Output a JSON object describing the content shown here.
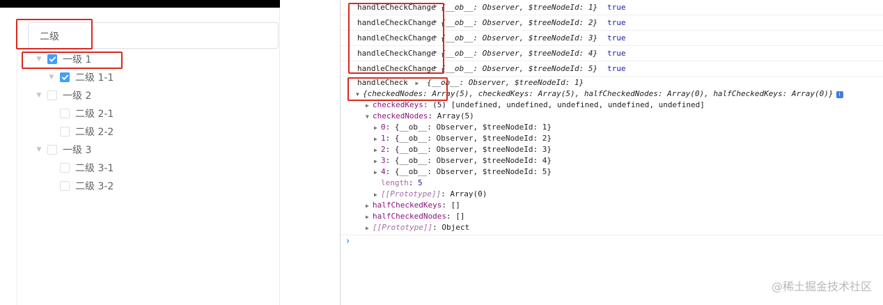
{
  "app": {
    "select_value": "二级",
    "tree": [
      {
        "label": "一级 1",
        "level": 0,
        "expanded": true,
        "checked": true
      },
      {
        "label": "二级 1-1",
        "level": 1,
        "expanded": false,
        "checked": true,
        "caret": true
      },
      {
        "label": "一级 2",
        "level": 0,
        "expanded": true,
        "checked": false
      },
      {
        "label": "二级 2-1",
        "level": 1,
        "checked": false
      },
      {
        "label": "二级 2-2",
        "level": 1,
        "checked": false
      },
      {
        "label": "一级 3",
        "level": 0,
        "expanded": true,
        "checked": false
      },
      {
        "label": "二级 3-1",
        "level": 1,
        "checked": false
      },
      {
        "label": "二级 3-2",
        "level": 1,
        "checked": false
      }
    ]
  },
  "console": {
    "check_change_logs": [
      {
        "name": "handleCheckChange",
        "obj": "{__ob__: Observer, $treeNodeId: 1}",
        "value": "true"
      },
      {
        "name": "handleCheckChange",
        "obj": "{__ob__: Observer, $treeNodeId: 2}",
        "value": "true"
      },
      {
        "name": "handleCheckChange",
        "obj": "{__ob__: Observer, $treeNodeId: 3}",
        "value": "true"
      },
      {
        "name": "handleCheckChange",
        "obj": "{__ob__: Observer, $treeNodeId: 4}",
        "value": "true"
      },
      {
        "name": "handleCheckChange",
        "obj": "{__ob__: Observer, $treeNodeId: 5}",
        "value": "true"
      }
    ],
    "check_log": {
      "name": "handleCheck",
      "obj": "{__ob__: Observer, $treeNodeId: 1}",
      "summary": "{checkedNodes: Array(5), checkedKeys: Array(5), halfCheckedNodes: Array(0), halfCheckedKeys: Array(0)}",
      "checked_keys_key": "checkedKeys",
      "checked_keys_value": "(5) [undefined, undefined, undefined, undefined, undefined]",
      "checked_nodes_key": "checkedNodes",
      "checked_nodes_value": "Array(5)",
      "node_entries": [
        {
          "key": "0",
          "value": "{__ob__: Observer, $treeNodeId: 1}"
        },
        {
          "key": "1",
          "value": "{__ob__: Observer, $treeNodeId: 2}"
        },
        {
          "key": "2",
          "value": "{__ob__: Observer, $treeNodeId: 3}"
        },
        {
          "key": "3",
          "value": "{__ob__: Observer, $treeNodeId: 4}"
        },
        {
          "key": "4",
          "value": "{__ob__: Observer, $treeNodeId: 5}"
        }
      ],
      "length_key": "length",
      "length_value": "5",
      "array_proto_key": "[[Prototype]]",
      "array_proto_value": "Array(0)",
      "half_checked_keys_key": "halfCheckedKeys",
      "half_checked_keys_value": "[]",
      "half_checked_nodes_key": "halfCheckedNodes",
      "half_checked_nodes_value": "[]",
      "object_proto_key": "[[Prototype]]",
      "object_proto_value": "Object"
    },
    "prompt_symbol": "›"
  },
  "watermark": "@稀土掘金技术社区",
  "colors": {
    "checkbox_checked": "#409eff",
    "annotation_red": "#d9281e",
    "console_key": "#881280",
    "console_number": "#1a1aa6"
  }
}
